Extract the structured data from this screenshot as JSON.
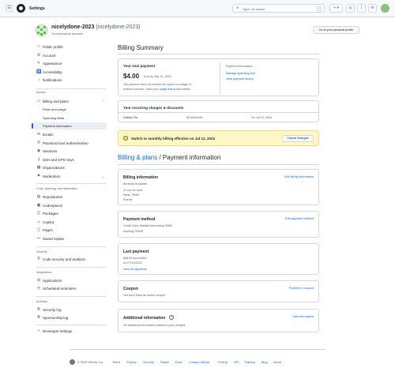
{
  "topbar": {
    "title": "Settings",
    "search_placeholder": "Type / to search",
    "search_icon": "search-icon",
    "kbd": "⌃",
    "buttons": [
      "+ ▾",
      "◎",
      "⟟",
      "▭",
      "✉"
    ]
  },
  "header": {
    "username": "nicelydone-2023",
    "secondary": "(nicelydone-2023)",
    "subtitle": "Your personal account",
    "go_profile": "Go to your personal profile"
  },
  "sidebar": {
    "top": [
      {
        "label": "Public profile",
        "icon": "person-icon"
      },
      {
        "label": "Account",
        "icon": "gear-icon"
      },
      {
        "label": "Appearance",
        "icon": "paintbrush-icon"
      },
      {
        "label": "Accessibility",
        "icon": "accessibility-icon"
      },
      {
        "label": "Notifications",
        "icon": "bell-icon"
      }
    ],
    "access_heading": "Access",
    "billing": {
      "label": "Billing and plans",
      "icon": "credit-card-icon"
    },
    "billing_sub": [
      "Plans and usage",
      "Spending limits",
      "Payment information"
    ],
    "access": [
      {
        "label": "Emails",
        "icon": "mail-icon"
      },
      {
        "label": "Password and authentication",
        "icon": "shield-icon"
      },
      {
        "label": "Sessions",
        "icon": "broadcast-icon"
      },
      {
        "label": "SSH and GPG keys",
        "icon": "key-icon"
      },
      {
        "label": "Organizations",
        "icon": "organization-icon"
      },
      {
        "label": "Moderation",
        "icon": "report-icon"
      }
    ],
    "code_heading": "Code, planning, and automation",
    "code": [
      {
        "label": "Repositories",
        "icon": "repo-icon"
      },
      {
        "label": "Codespaces",
        "icon": "codespaces-icon"
      },
      {
        "label": "Packages",
        "icon": "package-icon"
      },
      {
        "label": "Copilot",
        "icon": "copilot-icon"
      },
      {
        "label": "Pages",
        "icon": "browser-icon"
      },
      {
        "label": "Saved replies",
        "icon": "reply-icon"
      }
    ],
    "security_heading": "Security",
    "security": [
      {
        "label": "Code security and analysis",
        "icon": "shield-lock-icon"
      }
    ],
    "integrations_heading": "Integrations",
    "integrations": [
      {
        "label": "Applications",
        "icon": "apps-icon"
      },
      {
        "label": "Scheduled reminders",
        "icon": "clock-icon"
      }
    ],
    "archives_heading": "Archives",
    "archives": [
      {
        "label": "Security log",
        "icon": "log-icon"
      },
      {
        "label": "Sponsorship log",
        "icon": "log-icon"
      }
    ],
    "developer": {
      "label": "Developer settings",
      "icon": "code-icon"
    }
  },
  "summary": {
    "title": "Billing Summary",
    "next_payment_label": "Your next payment",
    "amount": "$4.00",
    "due": "Due by July 12, 2024",
    "note_1": "This amount does not include the spend on usage of",
    "note_2_prefix": "metered service. View your ",
    "note_link": "usage this month",
    "note_2_suffix": " below.",
    "payment_info": "Payment information →",
    "manage_link": "Manage spending limit",
    "history_link": "View payment history"
  },
  "recurring": {
    "title": "Your recurring charges & discounts",
    "plan": "GitHub Pro",
    "price": "$4.00/month",
    "date": "On Jul 12, 2024"
  },
  "banner": {
    "text": "Switch to monthly billing effective on Jul 12, 2024",
    "button": "Cancel changes"
  },
  "payment_page": {
    "breadcrumb_link": "Billing & plans",
    "breadcrumb_sep": " / ",
    "title": "Payment information"
  },
  "billing_info": {
    "title": "Billing information",
    "edit": "Edit billing information",
    "name": "Bertrand Bruandet",
    "addr1": "21 rue de rivoli",
    "addr2": "Paris, 75001",
    "addr3": "France"
  },
  "payment_method": {
    "title": "Payment method",
    "edit": "Edit payment method",
    "line1": "Credit Card: MasterCard ending 3558",
    "line2": "expiring 7/2028"
  },
  "last_payment": {
    "title": "Last payment",
    "line1": "$48.00 successful",
    "line2": "on 07/12/2023",
    "link": "View all payments"
  },
  "coupon": {
    "title": "Coupon",
    "action": "Redeem a coupon",
    "text": "You don't have an active coupon."
  },
  "additional": {
    "title": "Additional information",
    "action": "Add information",
    "text": "No additional information added to your receipts."
  },
  "footer": {
    "copy": "© 2023 GitHub, Inc.",
    "links": [
      "Terms",
      "Privacy",
      "Security",
      "Status",
      "Docs",
      "Contact GitHub",
      "Pricing",
      "API",
      "Training",
      "Blog",
      "About"
    ]
  }
}
